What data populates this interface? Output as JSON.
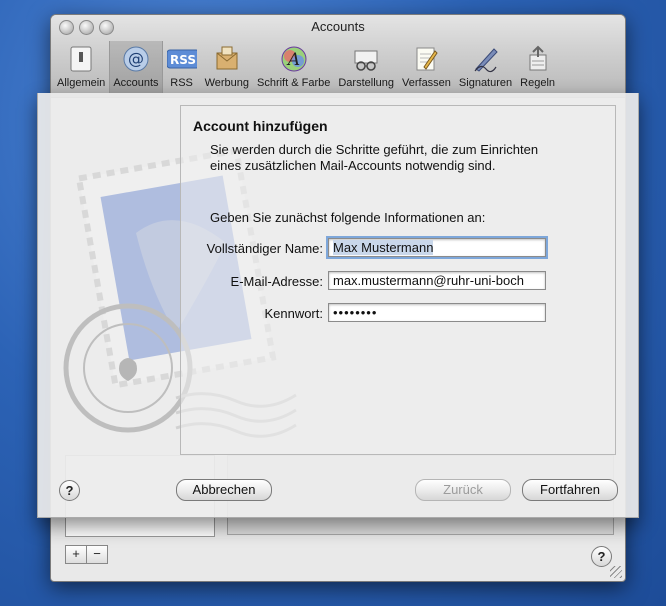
{
  "window": {
    "title": "Accounts"
  },
  "toolbar": {
    "items": [
      {
        "label": "Allgemein",
        "icon": "switch-icon"
      },
      {
        "label": "Accounts",
        "icon": "at-sign-icon",
        "active": true
      },
      {
        "label": "RSS",
        "icon": "rss-icon"
      },
      {
        "label": "Werbung",
        "icon": "junk-mail-icon"
      },
      {
        "label": "Schrift & Farbe",
        "icon": "fonts-colors-icon"
      },
      {
        "label": "Darstellung",
        "icon": "viewing-glasses-icon"
      },
      {
        "label": "Verfassen",
        "icon": "compose-pencil-icon"
      },
      {
        "label": "Signaturen",
        "icon": "signature-pen-icon"
      },
      {
        "label": "Regeln",
        "icon": "rules-icon"
      }
    ]
  },
  "sheet": {
    "heading": "Account hinzufügen",
    "intro": "Sie werden durch die Schritte geführt, die zum Einrichten eines zusätzlichen Mail-Accounts notwendig sind.",
    "prompt": "Geben Sie zunächst folgende Informationen an:",
    "fields": {
      "name_label": "Vollständiger Name:",
      "name_value": "Max Mustermann",
      "email_label": "E-Mail-Adresse:",
      "email_value": "max.mustermann@ruhr-uni-boch",
      "password_label": "Kennwort:",
      "password_value": "••••••••"
    },
    "buttons": {
      "help": "?",
      "cancel": "Abbrechen",
      "back": "Zurück",
      "continue": "Fortfahren"
    }
  },
  "prefs": {
    "add": "+",
    "remove": "−",
    "help": "?"
  }
}
